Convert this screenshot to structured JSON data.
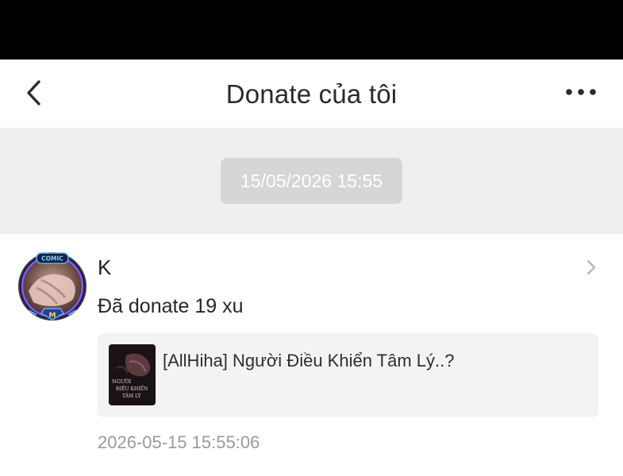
{
  "header": {
    "title": "Donate của tôi",
    "back_icon": "chevron-left-icon",
    "more_icon": "more-horizontal-icon"
  },
  "date_separator": {
    "label": "15/05/2026 15:55"
  },
  "donation": {
    "sender_name": "K",
    "avatar_badge": "COMIC",
    "message": "Đã donate 19 xu",
    "comic": {
      "title": "[AllHiha] Người Điều Khiển Tâm Lý..?",
      "cover_text": [
        "NGƯỜI",
        "ĐIỀU KHIỂN",
        "TÂM LÝ"
      ]
    },
    "timestamp": "2026-05-15 15:55:06",
    "chevron_icon": "chevron-right-icon"
  },
  "colors": {
    "status_bar": "#000000",
    "band_background": "#efefef",
    "pill_background": "#d6d6d6",
    "comic_box_background": "#f3f3f3",
    "timestamp_text": "#9a9a9a"
  }
}
